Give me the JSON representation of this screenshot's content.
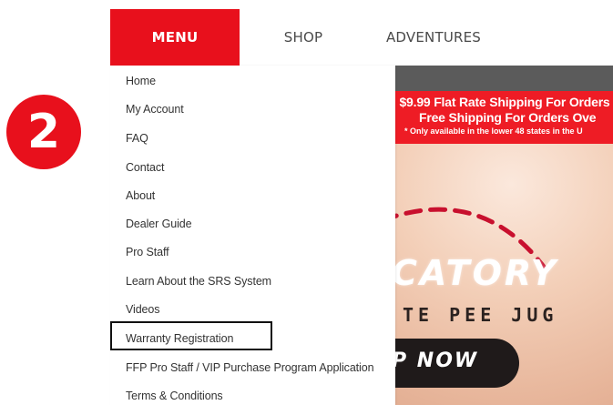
{
  "step_badge": {
    "number": "2",
    "color": "#e8101c"
  },
  "nav": {
    "tabs": [
      {
        "label": "MENU",
        "active": true
      },
      {
        "label": "SHOP",
        "active": false
      },
      {
        "label": "ADVENTURES",
        "active": false
      }
    ],
    "accent_color": "#e8101c"
  },
  "dropdown": {
    "items": [
      "Home",
      "My Account",
      "FAQ",
      "Contact",
      "About",
      "Dealer Guide",
      "Pro Staff",
      "Learn About the SRS System",
      "Videos",
      "Warranty Registration",
      "FFP Pro Staff / VIP Purchase Program Application",
      "Terms & Conditions"
    ],
    "highlighted_item": "Warranty Registration"
  },
  "hero": {
    "promo_line1": "$9.99 Flat Rate Shipping For Orders",
    "promo_line2": "Free Shipping For Orders Ove",
    "promo_line3": "* Only available in the lower 48 states in the U",
    "logo_text": "CATORY",
    "tagline": "TE PEE JUG",
    "cta_label": "P NOW",
    "promo_color": "#ee1c25"
  }
}
